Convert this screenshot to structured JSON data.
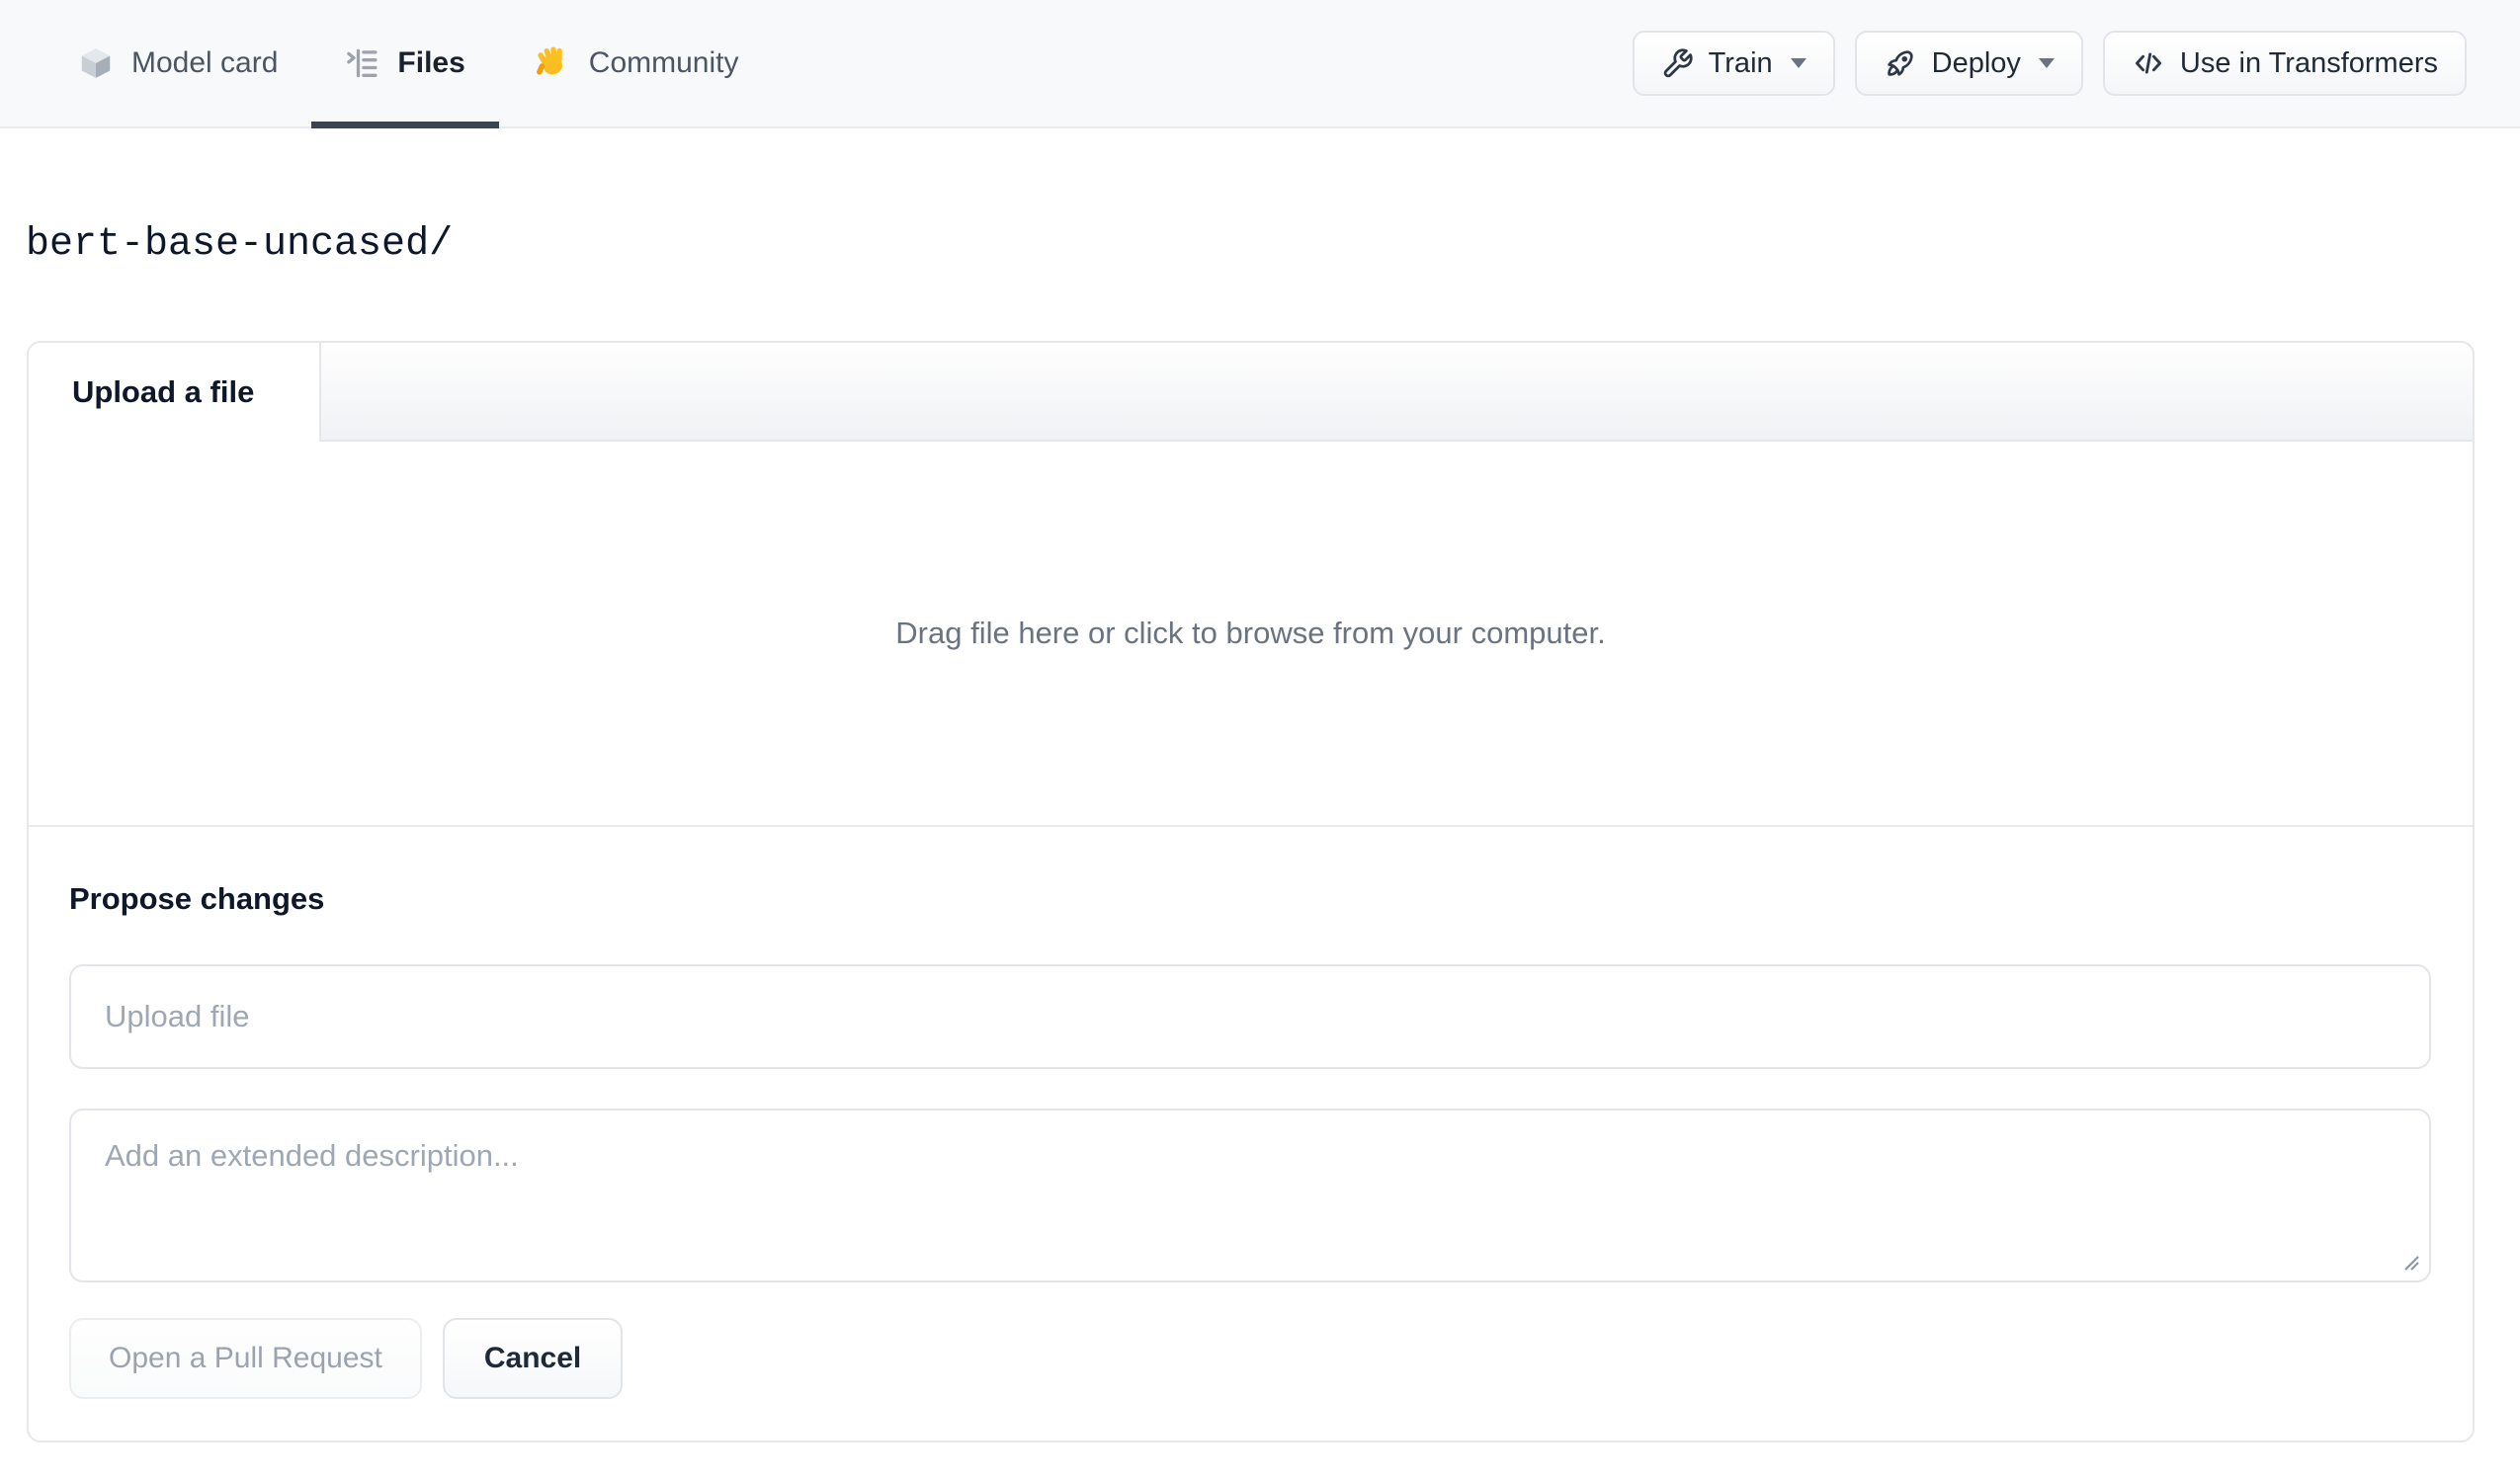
{
  "nav": {
    "tabs": [
      {
        "label": "Model card",
        "icon": "cube-icon",
        "active": false
      },
      {
        "label": "Files",
        "icon": "files-icon",
        "active": true
      },
      {
        "label": "Community",
        "icon": "wave-icon",
        "active": false
      }
    ],
    "actions": [
      {
        "label": "Train",
        "icon": "wrench-icon",
        "caret": true
      },
      {
        "label": "Deploy",
        "icon": "rocket-icon",
        "caret": true
      },
      {
        "label": "Use in Transformers",
        "icon": "code-icon",
        "caret": false
      }
    ]
  },
  "breadcrumb": {
    "path": "bert-base-uncased/"
  },
  "upload_card": {
    "tab_label": "Upload a file",
    "dropzone_text": "Drag file here or click to browse from your computer.",
    "propose_heading": "Propose changes",
    "file_input_placeholder": "Upload file",
    "description_placeholder": "Add an extended description...",
    "submit_label": "Open a Pull Request",
    "cancel_label": "Cancel"
  },
  "colors": {
    "nav_background": "#f8f9fb",
    "active_tab_underline": "#3b4352",
    "card_border": "#e5e7eb",
    "muted_text": "#6b7280",
    "placeholder_text": "#a0a7b4",
    "disabled_text": "#9ca3af",
    "emoji_hand": "#fbbf24"
  }
}
